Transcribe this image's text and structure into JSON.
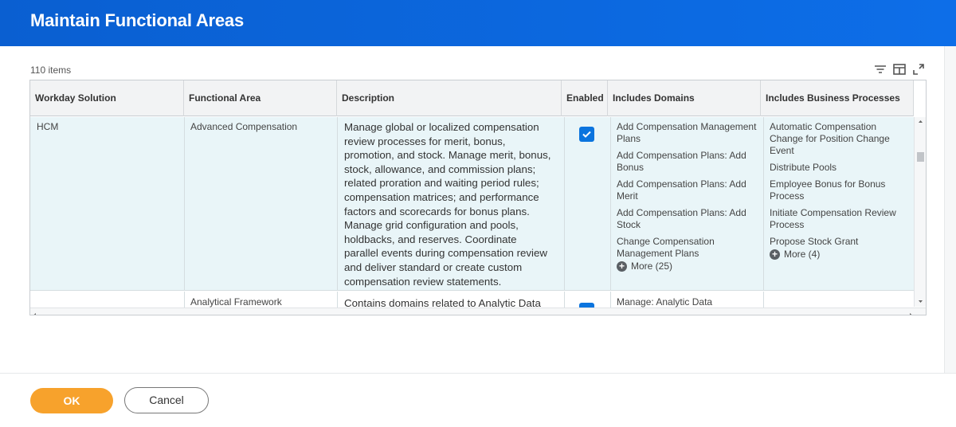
{
  "header": {
    "title": "Maintain Functional Areas"
  },
  "toolbar": {
    "item_count": "110 items"
  },
  "columns": [
    "Workday Solution",
    "Functional Area",
    "Description",
    "Enabled",
    "Includes Domains",
    "Includes Business Processes"
  ],
  "rows": [
    {
      "solution": "HCM",
      "functional_area": "Advanced Compensation",
      "description": "Manage global or localized compensation review processes for merit, bonus, promotion, and stock. Manage merit, bonus, stock, allowance, and commission plans; related proration and waiting period rules; compensation matrices; and performance factors and scorecards for bonus plans. Manage grid configuration and pools, holdbacks, and reserves. Coordinate parallel events during compensation review and deliver standard or create custom compensation review statements.",
      "enabled": true,
      "domains": [
        "Add Compensation Management Plans",
        "Add Compensation Plans: Add Bonus",
        "Add Compensation Plans: Add Merit",
        "Add Compensation Plans: Add Stock",
        "Change Compensation Management Plans"
      ],
      "domains_more": "More (25)",
      "business_processes": [
        "Automatic Compensation Change for Position Change Event",
        "Distribute Pools",
        "Employee Bonus for Bonus Process",
        "Initiate Compensation Review Process",
        "Propose Stock Grant"
      ],
      "bp_more": "More (4)"
    },
    {
      "solution": "",
      "functional_area": "Analytical Framework",
      "description": "Contains domains related to Analytic Data",
      "enabled": true,
      "domains": [
        "Manage: Analytic Data"
      ],
      "business_processes": []
    }
  ],
  "footer": {
    "ok_label": "OK",
    "cancel_label": "Cancel"
  },
  "colors": {
    "header": "#0a5fd1",
    "ok_button": "#f7a22c",
    "selected_row": "#e9f5f8",
    "checkbox": "#0b74de"
  },
  "icons": [
    "filter-icon",
    "column-layout-icon",
    "expand-icon",
    "checkmark-icon",
    "plus-circle-icon"
  ]
}
